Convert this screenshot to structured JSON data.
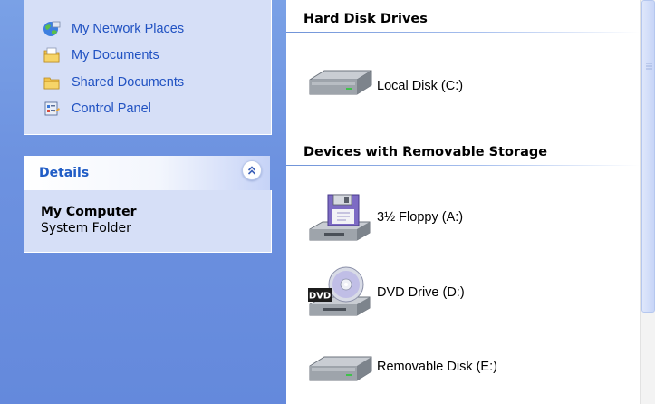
{
  "task_pane": {
    "other_places": [
      {
        "label": "My Network Places",
        "icon": "network-places-icon"
      },
      {
        "label": "My Documents",
        "icon": "my-documents-icon"
      },
      {
        "label": "Shared Documents",
        "icon": "shared-documents-icon"
      },
      {
        "label": "Control Panel",
        "icon": "control-panel-icon"
      }
    ],
    "details": {
      "title": "Details",
      "name": "My Computer",
      "type": "System Folder"
    }
  },
  "content": {
    "groups": [
      {
        "header": "Hard Disk Drives",
        "items": [
          {
            "label": "Local Disk (C:)",
            "icon": "hard-disk-icon"
          }
        ]
      },
      {
        "header": "Devices with Removable Storage",
        "items": [
          {
            "label": "3½ Floppy (A:)",
            "icon": "floppy-drive-icon"
          },
          {
            "label": "DVD Drive (D:)",
            "icon": "dvd-drive-icon"
          },
          {
            "label": "Removable Disk (E:)",
            "icon": "removable-disk-icon"
          }
        ]
      }
    ]
  },
  "colors": {
    "task_pane_bg": "#6d92e0",
    "panel_bg": "#d6dff7",
    "link_text": "#2152c2",
    "details_title": "#215dc6"
  }
}
